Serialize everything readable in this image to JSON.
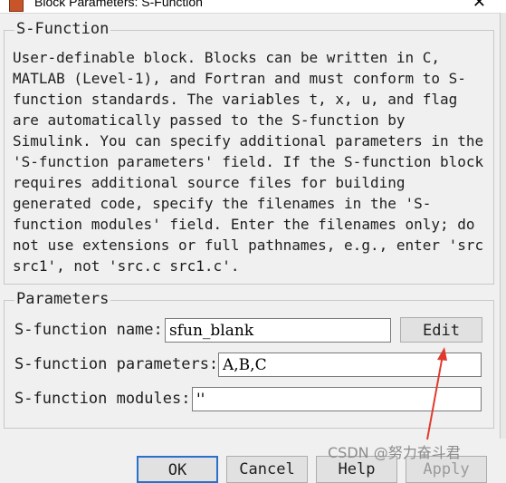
{
  "window": {
    "title": "Block Parameters: S-Function",
    "close_icon": "close-icon"
  },
  "description_group": {
    "title": "S-Function",
    "text": "User-definable block.  Blocks can be written in C, MATLAB (Level-1), and Fortran and must conform to S-function standards.  The variables t, x, u, and flag are automatically passed to the S-function by Simulink.  You can specify additional parameters in the 'S-function parameters' field. If the S-function block requires additional source files for building generated code, specify the filenames in the 'S-function modules' field. Enter the filenames only; do not use extensions or full pathnames, e.g., enter 'src src1', not 'src.c src1.c'."
  },
  "parameters_group": {
    "title": "Parameters",
    "name_label": "S-function name:",
    "name_value": "sfun_blank",
    "edit_button": "Edit",
    "params_label": "S-function parameters:",
    "params_value": "A,B,C",
    "modules_label": "S-function modules:",
    "modules_value": "''"
  },
  "footer_buttons": {
    "ok": "OK",
    "cancel": "Cancel",
    "help": "Help",
    "apply": "Apply"
  },
  "watermark": "CSDN @努力奋斗君",
  "annotation_color": "#e03a2e"
}
